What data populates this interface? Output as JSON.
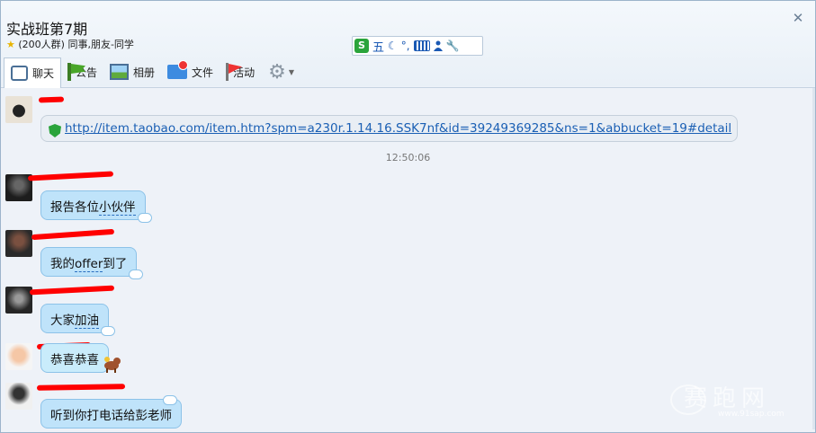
{
  "window": {
    "title": "实战班第7期",
    "member_count": "(200人群)",
    "tags": "同事,朋友-同学"
  },
  "ime": {
    "wu": "五",
    "punct": "°,"
  },
  "tabs": [
    {
      "label": "聊天",
      "icon": "chat-bubble-icon"
    },
    {
      "label": "公告",
      "icon": "flag-icon"
    },
    {
      "label": "相册",
      "icon": "photo-icon"
    },
    {
      "label": "文件",
      "icon": "folder-icon"
    },
    {
      "label": "活动",
      "icon": "red-flag-icon"
    }
  ],
  "messages": [
    {
      "type": "link",
      "text": "http://item.taobao.com/item.htm?spm=a230r.1.14.16.SSK7nf&id=39249369285&ns=1&abbucket=19#detail"
    },
    {
      "type": "timestamp",
      "text": "12:50:06"
    },
    {
      "type": "text",
      "parts": [
        "报告各位",
        "小伙伴"
      ]
    },
    {
      "type": "text",
      "parts": [
        "我的",
        "offer",
        "到了"
      ]
    },
    {
      "type": "text",
      "parts": [
        "大家",
        "加油"
      ]
    },
    {
      "type": "text",
      "parts": [
        "恭喜恭喜"
      ]
    },
    {
      "type": "text",
      "parts": [
        "听到你打电话给彭老师"
      ]
    }
  ],
  "watermark": {
    "main": "赛跑网",
    "sub": "www.91sap.com"
  },
  "colors": {
    "bubble": "#bfe3fa",
    "link": "#1a5fb4",
    "redaction": "#ff0000"
  }
}
